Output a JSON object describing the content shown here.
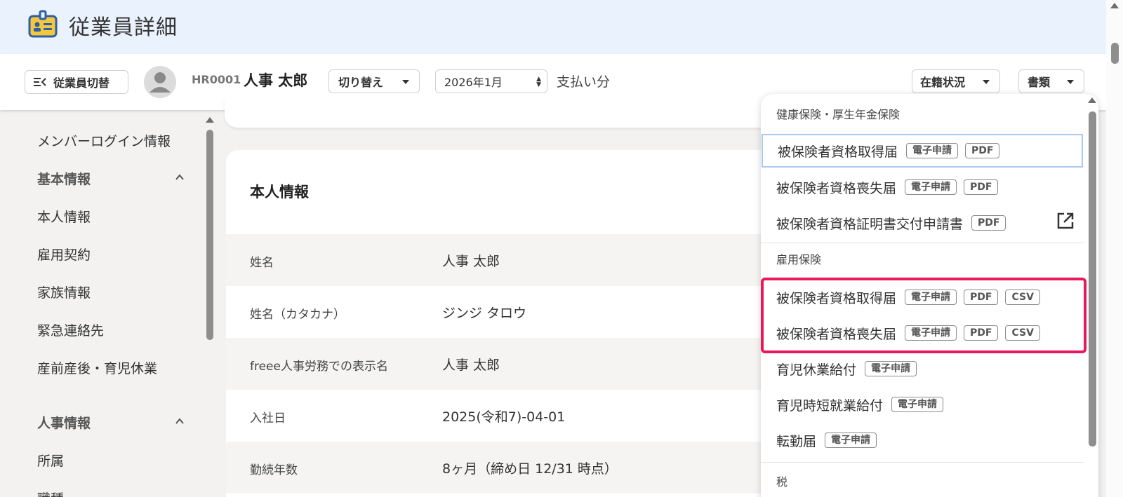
{
  "header": {
    "title": "従業員詳細"
  },
  "toolbar": {
    "switch_employee_label": "従業員切替",
    "employee_code": "HR0001",
    "employee_name": "人事 太郎",
    "switch_label": "切り替え",
    "month_value": "2026年1月",
    "pay_label": "支払い分",
    "status_label": "在籍状況",
    "documents_label": "書類"
  },
  "sidebar": {
    "items": [
      {
        "label": "メンバーログイン情報"
      },
      {
        "label": "基本情報"
      },
      {
        "label": "本人情報"
      },
      {
        "label": "雇用契約"
      },
      {
        "label": "家族情報"
      },
      {
        "label": "緊急連絡先"
      },
      {
        "label": "産前産後・育児休業"
      },
      {
        "label": "人事情報"
      },
      {
        "label": "所属"
      },
      {
        "label": "職種"
      }
    ]
  },
  "main": {
    "section_title": "本人情報",
    "rows": [
      {
        "label": "姓名",
        "value": "人事 太郎"
      },
      {
        "label": "姓名（カタカナ）",
        "value": "ジンジ タロウ"
      },
      {
        "label": "freee人事労務での表示名",
        "value": "人事 太郎"
      },
      {
        "label": "入社日",
        "value": "2025(令和7)-04-01"
      },
      {
        "label": "勤続年数",
        "value": "8ヶ月（締め日 12/31 時点）"
      }
    ]
  },
  "documents_menu": {
    "groups": [
      {
        "title": "健康保険・厚生年金保険",
        "items": [
          {
            "label": "被保険者資格取得届",
            "tags": [
              "電子申請",
              "PDF"
            ]
          },
          {
            "label": "被保険者資格喪失届",
            "tags": [
              "電子申請",
              "PDF"
            ]
          },
          {
            "label": "被保険者資格証明書交付申請書",
            "tags": [
              "PDF"
            ]
          }
        ]
      },
      {
        "title": "雇用保険",
        "items": [
          {
            "label": "被保険者資格取得届",
            "tags": [
              "電子申請",
              "PDF",
              "CSV"
            ]
          },
          {
            "label": "被保険者資格喪失届",
            "tags": [
              "電子申請",
              "PDF",
              "CSV"
            ]
          },
          {
            "label": "育児休業給付",
            "tags": [
              "電子申請"
            ]
          },
          {
            "label": "育児時短就業給付",
            "tags": [
              "電子申請"
            ]
          },
          {
            "label": "転勤届",
            "tags": [
              "電子申請"
            ]
          }
        ]
      },
      {
        "title": "税",
        "items": []
      }
    ]
  },
  "colors": {
    "header_bg": "#eaf2fd",
    "highlight": "#e8195a",
    "focus_ring": "#a9c8f2"
  }
}
